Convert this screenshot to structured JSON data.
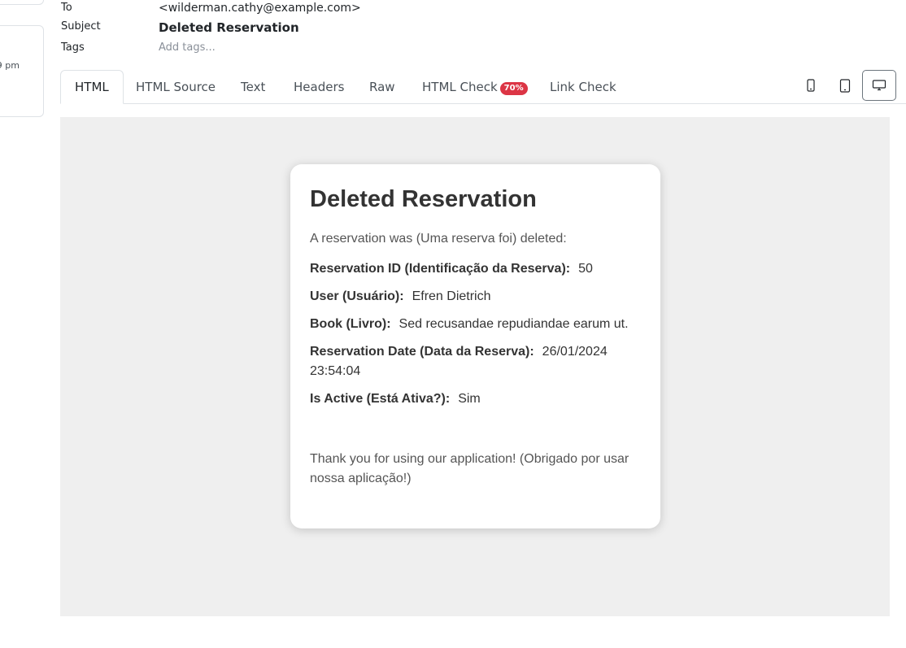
{
  "header": {
    "to_label": "To",
    "to_value": "<wilderman.cathy@example.com>",
    "subject_label": "Subject",
    "subject_value": "Deleted Reservation",
    "tags_label": "Tags",
    "tags_placeholder": "Add tags..."
  },
  "sidebar": {
    "time_fragment": "9 pm"
  },
  "tabs": [
    {
      "label": "HTML",
      "active": true
    },
    {
      "label": "HTML Source"
    },
    {
      "label": "Text"
    },
    {
      "label": "Headers"
    },
    {
      "label": "Raw"
    },
    {
      "label": "HTML Check",
      "badge": "70%"
    },
    {
      "label": "Link Check"
    }
  ],
  "device_buttons": [
    {
      "icon": "phone-icon"
    },
    {
      "icon": "tablet-icon"
    },
    {
      "icon": "desktop-icon",
      "active": true
    }
  ],
  "email": {
    "title": "Deleted Reservation",
    "intro": "A reservation was (Uma reserva foi) deleted:",
    "fields": [
      {
        "label": "Reservation ID (Identificação da Reserva):",
        "value": "50"
      },
      {
        "label": "User (Usuário):",
        "value": "Efren Dietrich"
      },
      {
        "label": "Book (Livro):",
        "value": "Sed recusandae repudiandae earum ut."
      },
      {
        "label": "Reservation Date (Data da Reserva):",
        "value": "26/01/2024 23:54:04"
      },
      {
        "label": "Is Active (Está Ativa?):",
        "value": "Sim"
      }
    ],
    "thanks": "Thank you for using our application! (Obrigado por usar nossa aplicação!)"
  },
  "colors": {
    "badge": "#dc3545",
    "preview_bg": "#efefef",
    "border": "#dee2e6"
  }
}
